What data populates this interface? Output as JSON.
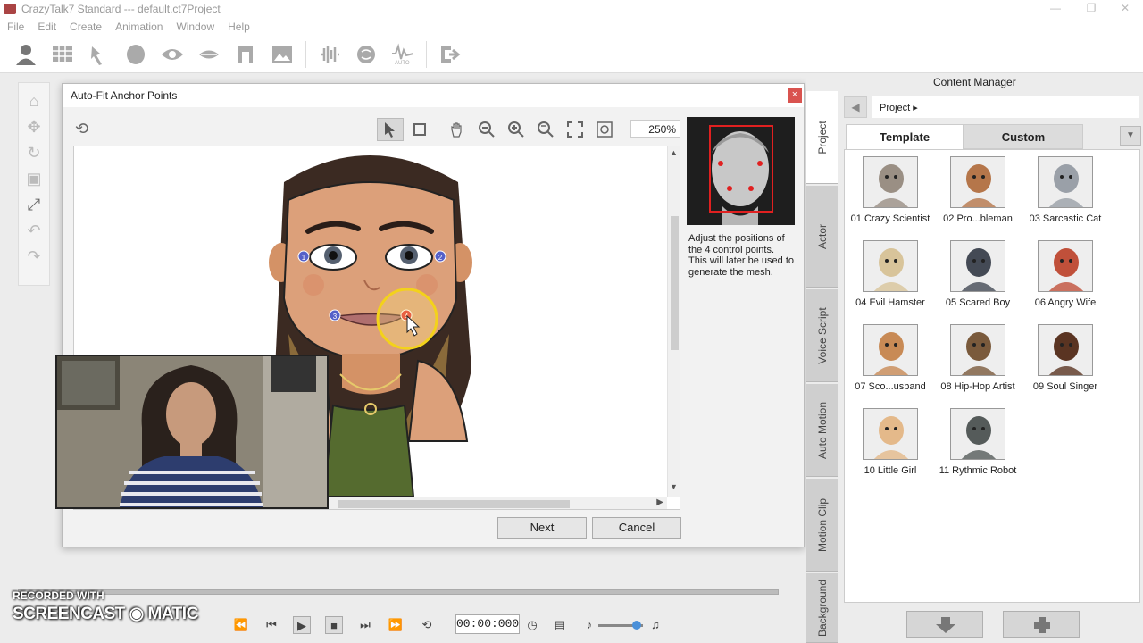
{
  "app": {
    "title": "CrazyTalk7 Standard --- default.ct7Project",
    "window_controls": [
      "—",
      "❐",
      "✕"
    ]
  },
  "menu": [
    "File",
    "Edit",
    "Create",
    "Animation",
    "Window",
    "Help"
  ],
  "dialog": {
    "title": "Auto-Fit Anchor Points",
    "close_glyph": "×",
    "zoom": "250%",
    "hint": "Adjust the positions of the 4 control points. This will later be used to generate the mesh.",
    "next_label": "Next",
    "cancel_label": "Cancel",
    "anchor_points": [
      "1",
      "2",
      "3",
      "4"
    ]
  },
  "content_manager": {
    "title": "Content Manager",
    "path": "Project",
    "tabs": {
      "template": "Template",
      "custom": "Custom"
    },
    "side_tabs": [
      "Project",
      "Actor",
      "Voice Script",
      "Auto Motion",
      "Motion Clip",
      "Background"
    ],
    "items": [
      {
        "label": "01 Crazy Scientist",
        "color": "#9a8f84"
      },
      {
        "label": "02 Pro...bleman",
        "color": "#b5764a"
      },
      {
        "label": "03 Sarcastic Cat",
        "color": "#9aa0a8"
      },
      {
        "label": "04 Evil Hamster",
        "color": "#d8c49a"
      },
      {
        "label": "05 Scared Boy",
        "color": "#444a55"
      },
      {
        "label": "06 Angry Wife",
        "color": "#c0503a"
      },
      {
        "label": "07 Sco...usband",
        "color": "#c88a55"
      },
      {
        "label": "08 Hip-Hop Artist",
        "color": "#7a5a3c"
      },
      {
        "label": "09 Soul Singer",
        "color": "#5a3422"
      },
      {
        "label": "10 Little Girl",
        "color": "#e4b98a"
      },
      {
        "label": "11 Rythmic Robot",
        "color": "#555b5a"
      }
    ]
  },
  "timeline": {
    "time": "00:00:000"
  },
  "watermark": {
    "line1": "RECORDED WITH",
    "line2": "SCREENCAST",
    "line3": "MATIC"
  }
}
